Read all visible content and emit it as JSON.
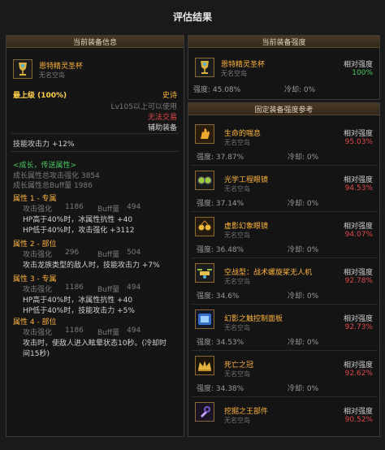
{
  "window": {
    "title": "评估结果"
  },
  "left": {
    "header": "当前装备信息",
    "item": {
      "name": "恩特精灵圣杯",
      "sub": "无名空岛",
      "icon": "chalice-icon"
    },
    "grade": "最上级 (100%)",
    "rarity": "史诗",
    "level_req": "Lv105以上可以使用",
    "trade": "无法交易",
    "type": "辅助装备",
    "skill_attack": "技能攻击力 +12%",
    "growth_title": "<成长，传送属性>",
    "growth_total_attack": "成长属性总攻击强化 3854",
    "growth_total_buff": "成长属性总Buff量 1986",
    "attrs": [
      {
        "title": "属性 1 - 专属",
        "row": {
          "a_label": "攻击强化",
          "a_val": "1186",
          "b_label": "Buff量",
          "b_val": "494"
        },
        "lines": [
          "HP高于40%时，冰属性抗性 +40",
          "HP低于40%时，攻击强化 +3112"
        ]
      },
      {
        "title": "属性 2 - 部位",
        "row": {
          "a_label": "攻击强化",
          "a_val": "296",
          "b_label": "Buff量",
          "b_val": "504"
        },
        "lines": [
          "攻击龙族类型的敌人时，技能攻击力 +7%"
        ]
      },
      {
        "title": "属性 3 - 专属",
        "row": {
          "a_label": "攻击强化",
          "a_val": "1186",
          "b_label": "Buff量",
          "b_val": "494"
        },
        "lines": [
          "HP高于40%时，冰属性抗性 +40",
          "HP低于40%时，技能攻击力 +5%"
        ]
      },
      {
        "title": "属性 4 - 部位",
        "row": {
          "a_label": "攻击强化",
          "a_val": "1186",
          "b_label": "Buff量",
          "b_val": "494"
        },
        "lines": [
          "攻击时，使敌人进入眩晕状态10秒。(冷却时",
          "间15秒)"
        ]
      }
    ]
  },
  "current_strength": {
    "header": "当前装备强度",
    "item": {
      "name": "恩特精灵圣杯",
      "sub": "无名空岛",
      "icon": "chalice-icon"
    },
    "rel_label": "相对强度",
    "rel_value": "100%",
    "strength": "强度: 45.08%",
    "cooldown": "冷却: 0%"
  },
  "reference": {
    "header": "固定装备强度参考",
    "rel_label": "相对强度",
    "items": [
      {
        "name": "生命的喘息",
        "sub": "无名空岛",
        "rel": "95.03%",
        "strength": "强度: 37.87%",
        "cooldown": "冷却: 0%",
        "icon": "hand-icon"
      },
      {
        "name": "光学工程眼镜",
        "sub": "无名空岛",
        "rel": "94.53%",
        "strength": "强度: 37.14%",
        "cooldown": "冷却: 0%",
        "icon": "goggles-icon"
      },
      {
        "name": "虚影幻象眼镜",
        "sub": "无名空岛",
        "rel": "94.07%",
        "strength": "强度: 36.48%",
        "cooldown": "冷却: 0%",
        "icon": "glasses-icon"
      },
      {
        "name": "空战型：战术螺旋桨无人机",
        "sub": "无名空岛",
        "rel": "92.78%",
        "strength": "强度: 34.6%",
        "cooldown": "冷却: 0%",
        "icon": "drone-icon"
      },
      {
        "name": "幻影之触控制面板",
        "sub": "无名空岛",
        "rel": "92.73%",
        "strength": "强度: 34.53%",
        "cooldown": "冷却: 0%",
        "icon": "panel-icon"
      },
      {
        "name": "死亡之冠",
        "sub": "无名空岛",
        "rel": "92.62%",
        "strength": "强度: 34.38%",
        "cooldown": "冷却: 0%",
        "icon": "crown-icon"
      },
      {
        "name": "挖掘之王部件",
        "sub": "无名空岛",
        "rel": "90.52%",
        "strength": "",
        "cooldown": "",
        "icon": "wrench-icon"
      }
    ]
  },
  "colors": {
    "gold": "#ffb43a",
    "green": "#47c85f",
    "red": "#e04848"
  }
}
